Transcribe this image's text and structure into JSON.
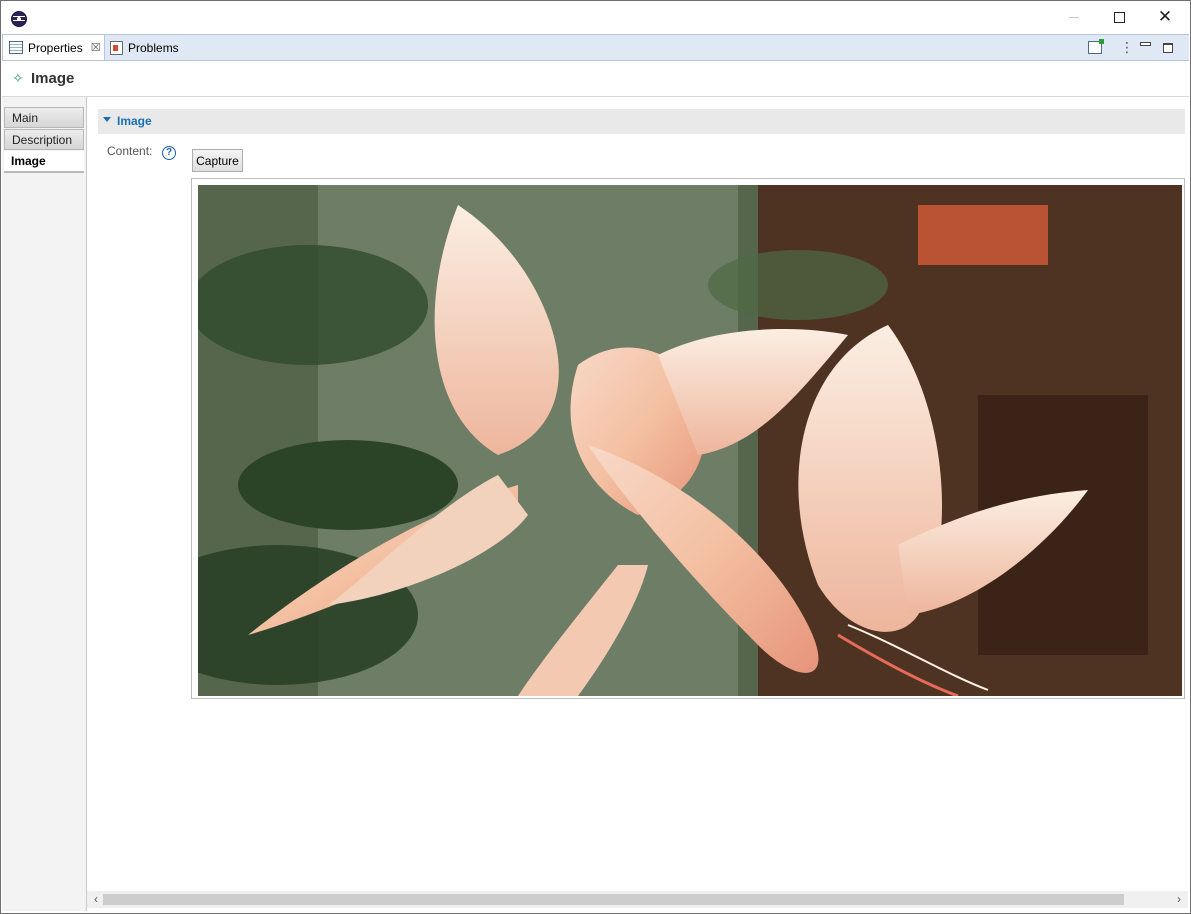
{
  "tabs": {
    "properties_label": "Properties",
    "problems_label": "Problems",
    "close_glyph": "☒"
  },
  "window_controls": {
    "close_glyph": "✕"
  },
  "header": {
    "title": "Image",
    "icon": "sparkle-icon"
  },
  "left_tabs": {
    "items": [
      "Main",
      "Description",
      "Image"
    ],
    "selected": "Image"
  },
  "section": {
    "title": "Image",
    "content_label": "Content:",
    "help_glyph": "?",
    "capture_label": "Capture"
  },
  "image": {
    "subject": "flower-photo",
    "alt": "Pink cactus flower photo"
  },
  "scrollbar": {
    "left_glyph": "‹",
    "right_glyph": "›"
  }
}
